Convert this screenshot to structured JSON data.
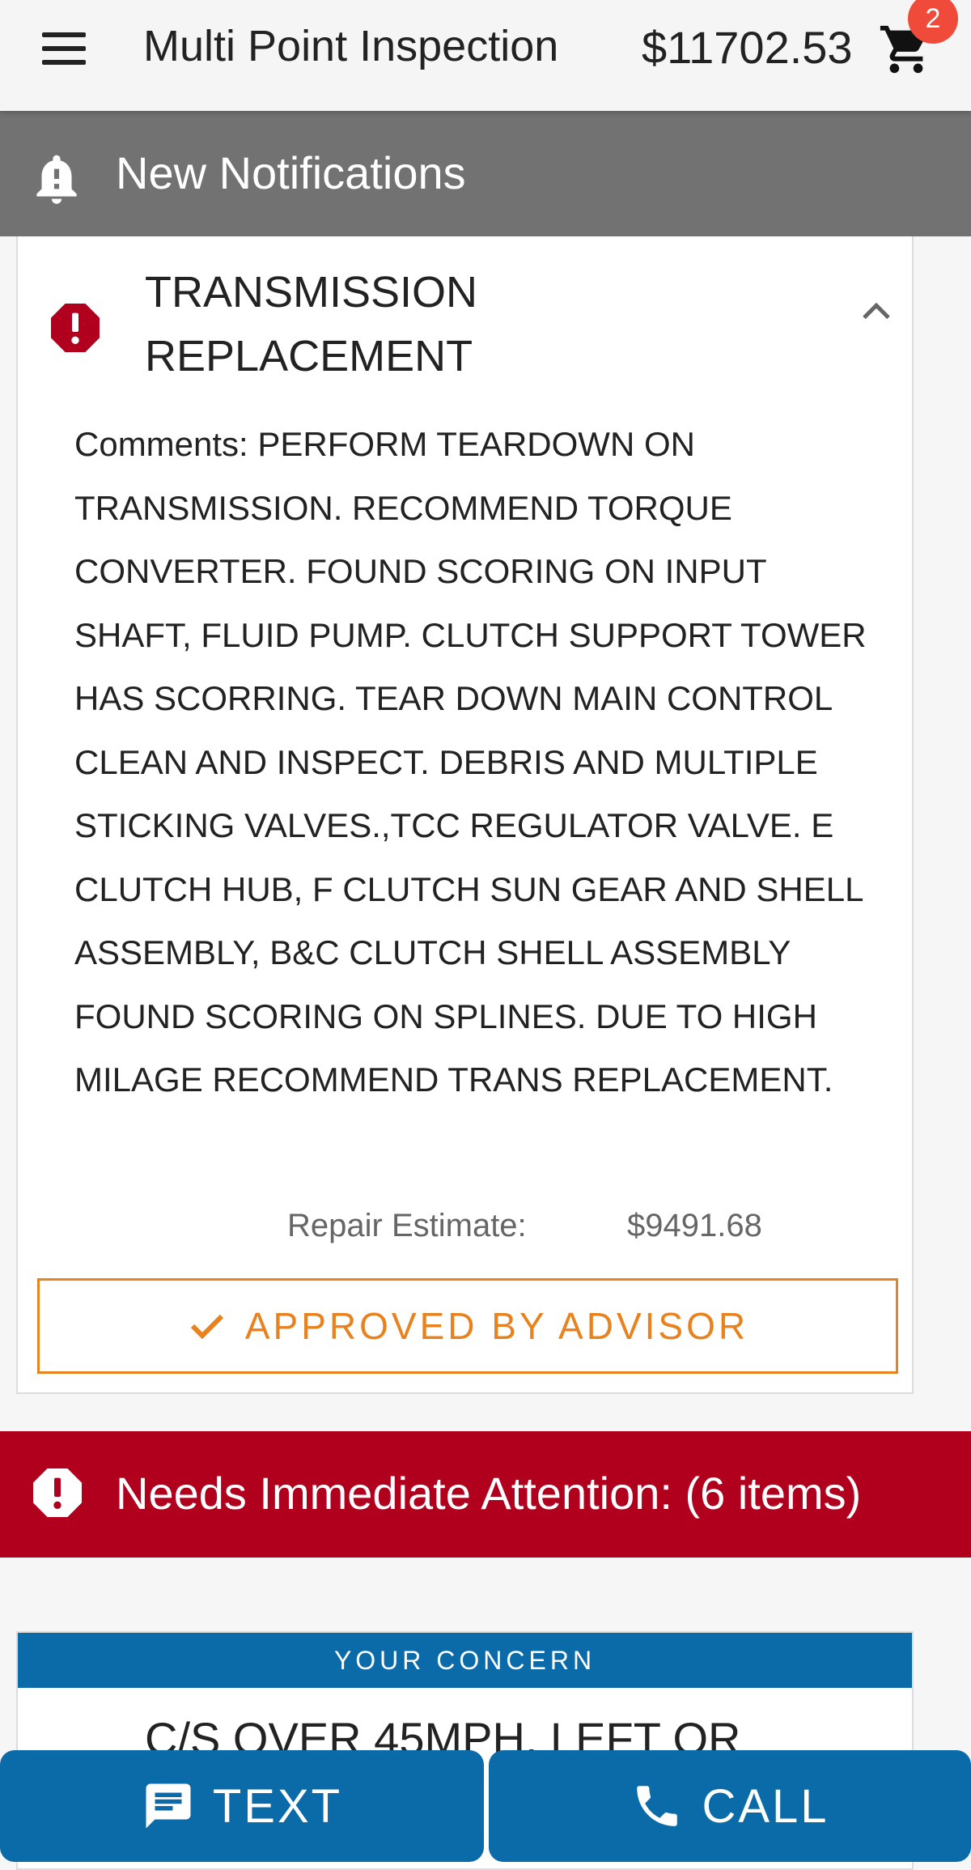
{
  "header": {
    "title": "Multi Point Inspection",
    "total": "$11702.53",
    "cart_count": "2",
    "menu_icon": "hamburger-menu-icon",
    "cart_icon": "shopping-cart-icon"
  },
  "notifications": {
    "label": "New Notifications",
    "icon": "bell-alert-icon"
  },
  "inspection_item": {
    "title": "TRANSMISSION REPLACEMENT",
    "comments": "Comments: PERFORM TEARDOWN ON TRANSMISSION. RECOMMEND TORQUE CONVERTER. FOUND SCORING ON INPUT SHAFT, FLUID PUMP. CLUTCH SUPPORT TOWER HAS SCORRING. TEAR DOWN MAIN CONTROL CLEAN AND INSPECT. DEBRIS AND MULTIPLE STICKING VALVES.,TCC REGULATOR VALVE. E CLUTCH HUB, F CLUTCH SUN GEAR AND SHELL ASSEMBLY, B&C CLUTCH SHELL ASSEMBLY FOUND SCORING ON SPLINES. DUE TO HIGH MILAGE RECOMMEND TRANS REPLACEMENT.",
    "estimate_label": "Repair Estimate:",
    "estimate_value": "$9491.68",
    "status_label": "APPROVED BY ADVISOR",
    "status_icon": "checkmark-icon",
    "alert_icon": "alert-octagon-icon"
  },
  "attention": {
    "label": "Needs Immediate Attention: (6 items)",
    "icon": "alert-octagon-icon"
  },
  "concern": {
    "header": "YOUR CONCERN",
    "text": "C/S OVER 45MPH, LEFT OR"
  },
  "actions": {
    "text_label": "TEXT",
    "call_label": "CALL"
  },
  "colors": {
    "primary": "#0b6aa8",
    "alert": "#b0001e",
    "approved": "#e8821f",
    "notification_bar": "#727272",
    "badge": "#f04a3a"
  }
}
